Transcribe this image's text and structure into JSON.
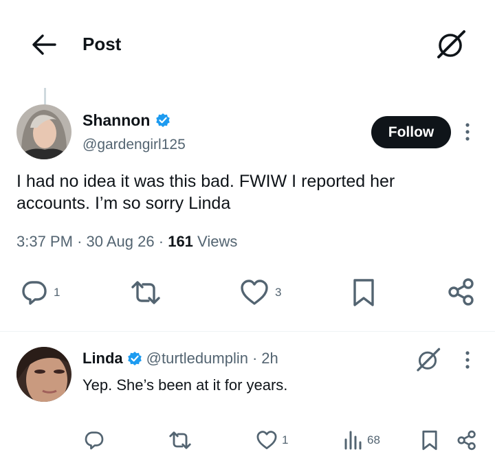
{
  "header": {
    "title": "Post",
    "back_icon": "arrow-left-icon",
    "grok_icon": "grok-icon"
  },
  "main_post": {
    "author_name": "Shannon",
    "verified_icon": "verified-badge-icon",
    "handle": "@gardengirl125",
    "follow_label": "Follow",
    "text_line1": "I had no idea it was this bad. FWIW I reported her",
    "text_line2": "accounts. I’m so sorry Linda",
    "time": "3:37 PM",
    "date": "30 Aug 26",
    "views_count": "161",
    "views_label": "Views",
    "actions": {
      "replies": "1",
      "likes": "3"
    }
  },
  "reply": {
    "author_name": "Linda",
    "handle": "@turtledumplin",
    "age": "2h",
    "text": "Yep. She’s been at it for years.",
    "actions": {
      "likes": "1",
      "views": "68"
    }
  },
  "colors": {
    "text": "#0f1419",
    "secondary": "#536471",
    "verified": "#1d9bf0",
    "follow_bg": "#0f1419"
  }
}
